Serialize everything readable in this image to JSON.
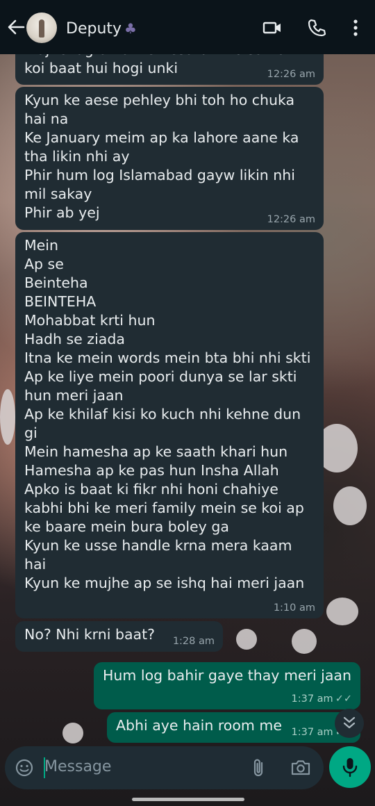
{
  "header": {
    "contact_name": "Deputy",
    "contact_suffix": "♣"
  },
  "messages": [
    {
      "direction": "incoming",
      "text": "Mujhe lagta hai ke Aesa bhi ho sakta\nkoi baat hui hogi unki",
      "time": "12:26 am"
    },
    {
      "direction": "incoming",
      "text": "Kyun ke aese pehley bhi toh ho chuka\nhai na\nKe January meim ap ka lahore aane ka\ntha likin nhi ay\nPhir hum log Islamabad gayw likin nhi\nmil sakay\nPhir ab yej",
      "time": "12:26 am"
    },
    {
      "direction": "incoming",
      "text": "Mein\nAp se\nBeinteha\nBEINTEHA\nMohabbat krti hun\nHadh se ziada\nItna ke mein words mein bta bhi nhi skti\nAp ke liye mein poori dunya se lar skti\nhun meri jaan\nAp ke khilaf kisi ko kuch nhi kehne dun\ngi\nMein hamesha ap ke saath khari hun\nHamesha ap ke pas hun Insha Allah\nApko is baat ki fikr nhi honi chahiye\nkabhi bhi ke meri family mein se koi ap\nke baare mein bura boley ga\nKyun ke usse handle krna mera kaam\nhai\nKyun ke mujhe ap se ishq hai meri jaan",
      "time": "1:10 am"
    },
    {
      "direction": "incoming",
      "text": "No? Nhi krni baat?",
      "time": "1:28 am"
    },
    {
      "direction": "outgoing",
      "text": "Hum log bahir gaye thay meri jaan",
      "time": "1:37 am",
      "status": "✓✓"
    },
    {
      "direction": "outgoing",
      "text": "Abhi aye hain room me",
      "time": "1:37 am",
      "status": "✓✓"
    }
  ],
  "composer": {
    "placeholder": "Message"
  },
  "icons": {
    "back": "back-arrow-icon",
    "video": "video-call-icon",
    "call": "phone-call-icon",
    "menu": "more-vertical-icon",
    "emoji": "emoji-icon",
    "attach": "paperclip-icon",
    "camera": "camera-icon",
    "mic": "microphone-icon",
    "scroll": "double-chevron-down-icon"
  },
  "colors": {
    "header_bg": "#0b141a",
    "incoming_bubble": "#202c33",
    "outgoing_bubble": "#005c4b",
    "accent": "#00a884"
  }
}
